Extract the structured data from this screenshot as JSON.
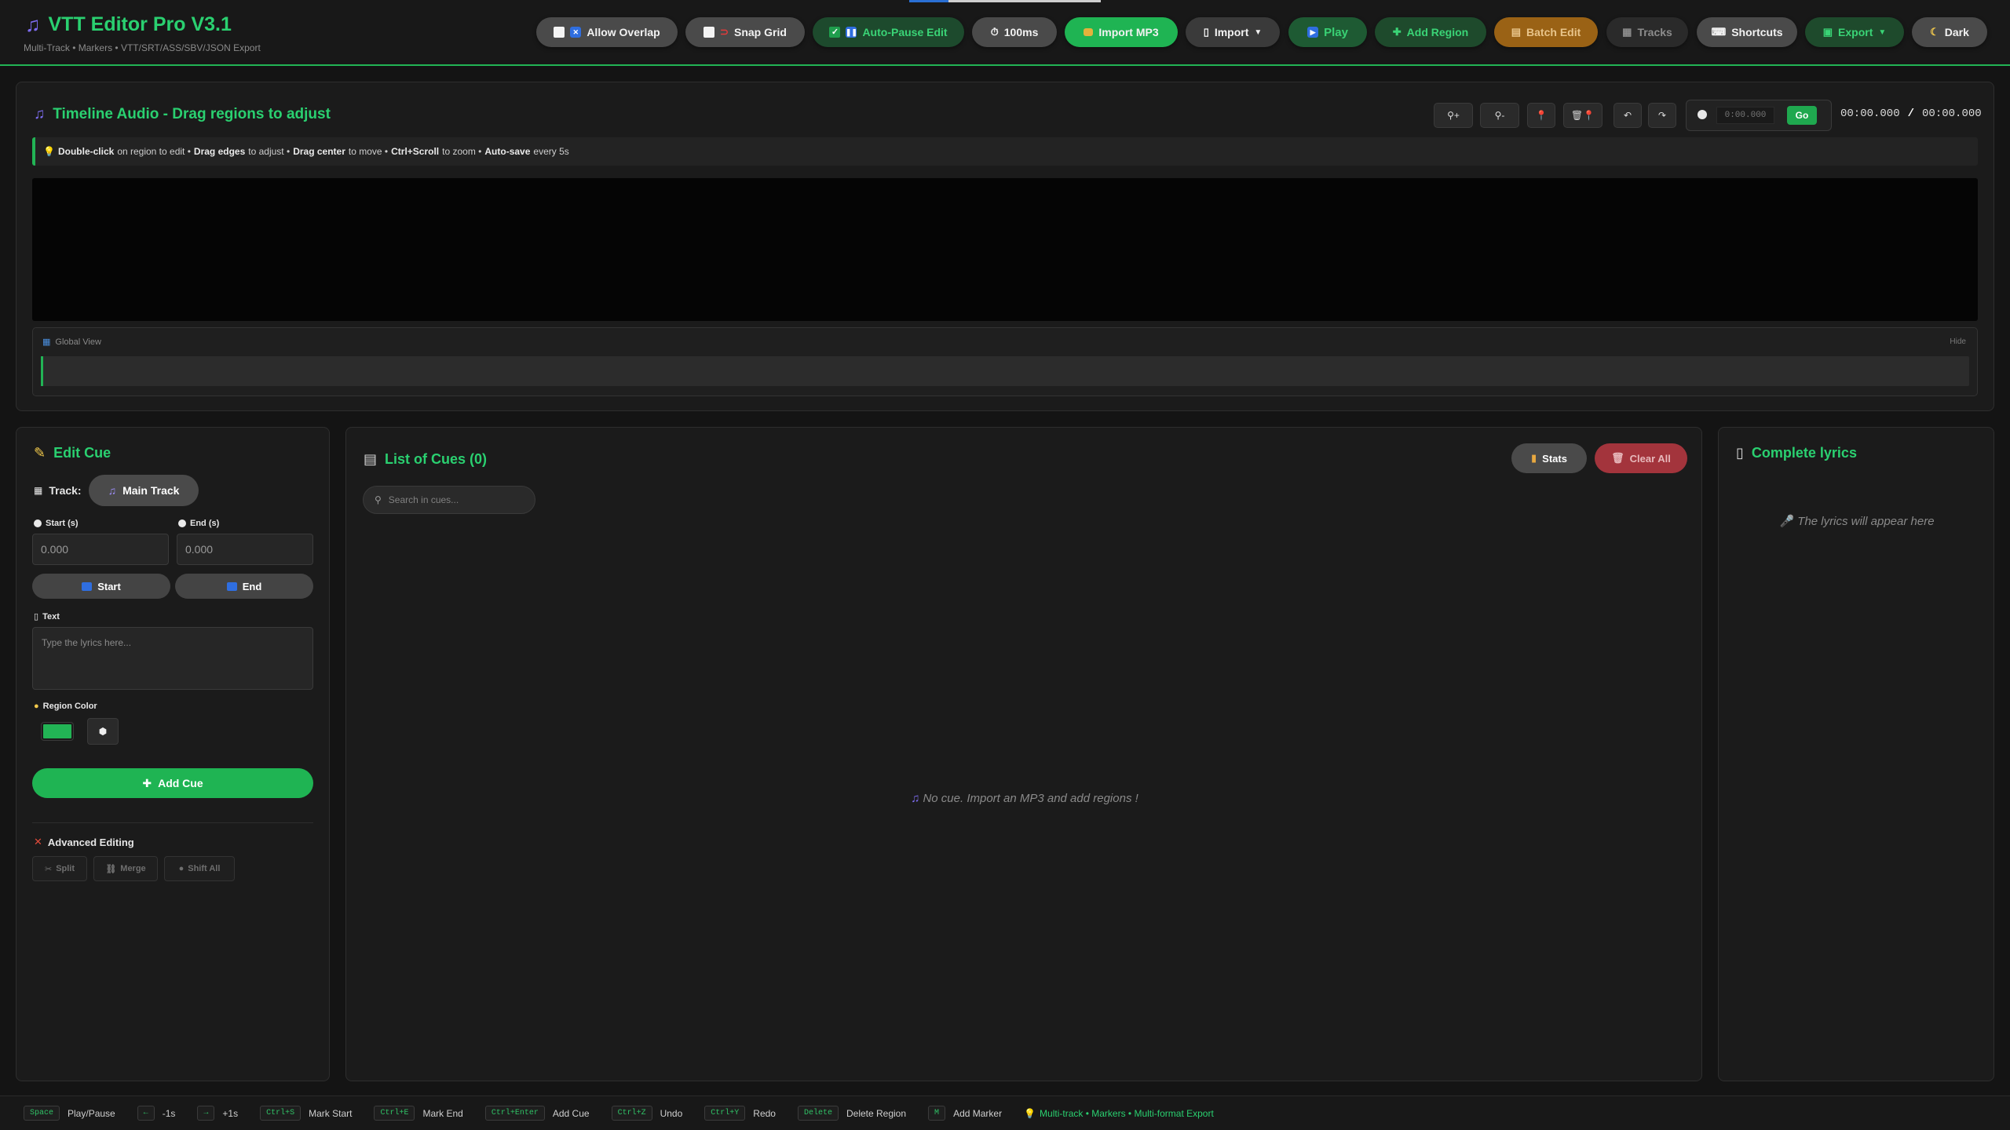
{
  "header": {
    "title": "VTT Editor Pro V3.1",
    "subtitle": "Multi-Track • Markers • VTT/SRT/ASS/SBV/JSON Export",
    "buttons": {
      "allow_overlap": "Allow Overlap",
      "snap_grid": "Snap Grid",
      "auto_pause_edit": "Auto-Pause Edit",
      "interval": "100ms",
      "import_mp3": "Import MP3",
      "import": "Import",
      "play": "Play",
      "add_region": "Add Region",
      "batch_edit": "Batch Edit",
      "tracks": "Tracks",
      "shortcuts": "Shortcuts",
      "export": "Export",
      "theme": "Dark"
    }
  },
  "timeline": {
    "title": "Timeline Audio - Drag regions to adjust",
    "goto_placeholder": "0:00.000",
    "goto_button": "Go",
    "current_time": "00:00.000",
    "separator": "/",
    "total_time": "00:00.000",
    "tip": {
      "a_bold": "Double-click",
      "a_text": "on region to edit •",
      "b_bold": "Drag edges",
      "b_text": "to adjust •",
      "c_bold": "Drag center",
      "c_text": "to move •",
      "d_bold": "Ctrl+Scroll",
      "d_text": "to zoom •",
      "e_bold": "Auto-save",
      "e_text": "every 5s"
    },
    "global_view": {
      "label": "Global View",
      "hide": "Hide"
    }
  },
  "edit_cue": {
    "title": "Edit Cue",
    "track_label": "Track:",
    "track_name": "Main Track",
    "start_label": "Start (s)",
    "end_label": "End (s)",
    "start_value": "0.000",
    "end_value": "0.000",
    "mark_start": "Start",
    "mark_end": "End",
    "text_label": "Text",
    "text_placeholder": "Type the lyrics here...",
    "color_label": "Region Color",
    "color_value": "#22b455",
    "add_cue": "Add Cue",
    "advanced_title": "Advanced Editing",
    "split": "Split",
    "merge": "Merge",
    "shift_all": "Shift All"
  },
  "cues": {
    "title": "List of Cues (0)",
    "stats": "Stats",
    "clear_all": "Clear All",
    "search_placeholder": "Search in cues...",
    "empty": "No cue. Import an MP3 and add regions !"
  },
  "lyrics": {
    "title": "Complete lyrics",
    "empty": "The lyrics will appear here"
  },
  "shortcuts": [
    {
      "key": "Space",
      "label": "Play/Pause"
    },
    {
      "key": "←",
      "label": "-1s"
    },
    {
      "key": "→",
      "label": "+1s"
    },
    {
      "key": "Ctrl+S",
      "label": "Mark Start"
    },
    {
      "key": "Ctrl+E",
      "label": "Mark End"
    },
    {
      "key": "Ctrl+Enter",
      "label": "Add Cue"
    },
    {
      "key": "Ctrl+Z",
      "label": "Undo"
    },
    {
      "key": "Ctrl+Y",
      "label": "Redo"
    },
    {
      "key": "Delete",
      "label": "Delete Region"
    },
    {
      "key": "M",
      "label": "Add Marker"
    }
  ],
  "footer_note": "Multi-track • Markers • Multi-format Export",
  "colors": {
    "accent": "#22b455",
    "danger": "#a3343c",
    "warning": "#c27a16"
  }
}
